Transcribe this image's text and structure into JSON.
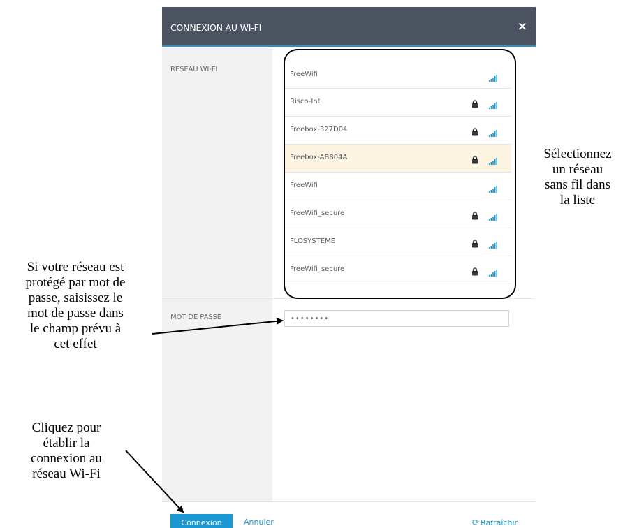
{
  "dialog": {
    "title": "CONNEXION AU WI-FI",
    "close_symbol": "×",
    "wifi_label": "RESEAU WI-FI",
    "password_label": "MOT DE PASSE",
    "password_value": "••••••••",
    "connect_label": "Connexion",
    "cancel_label": "Annuler",
    "refresh_label": "Rafraîchir",
    "refresh_icon": "refresh-icon",
    "accent_color": "#1b98d1",
    "header_color": "#4a535f",
    "selected_row_color": "#fcf3e0"
  },
  "networks": [
    {
      "name": "FreeWifi",
      "secured": false,
      "selected": false
    },
    {
      "name": "Risco-Int",
      "secured": true,
      "selected": false
    },
    {
      "name": "Freebox-327D04",
      "secured": true,
      "selected": false
    },
    {
      "name": "Freebox-AB804A",
      "secured": true,
      "selected": true
    },
    {
      "name": "FreeWifi",
      "secured": false,
      "selected": false
    },
    {
      "name": "FreeWifi_secure",
      "secured": true,
      "selected": false
    },
    {
      "name": "FLOSYSTEME",
      "secured": true,
      "selected": false
    },
    {
      "name": "FreeWifi_secure",
      "secured": true,
      "selected": false
    }
  ],
  "annotations": {
    "select_network": [
      "Sélectionnez",
      "un réseau",
      "sans fil dans",
      "la liste"
    ],
    "password_hint": [
      "Si votre réseau est",
      "protégé par mot de",
      "passe, saisissez le",
      "mot de passe dans",
      "le champ prévu à",
      "cet effet"
    ],
    "connect_hint": [
      "Cliquez pour",
      "établir la",
      "connexion au",
      "réseau Wi-Fi"
    ]
  }
}
